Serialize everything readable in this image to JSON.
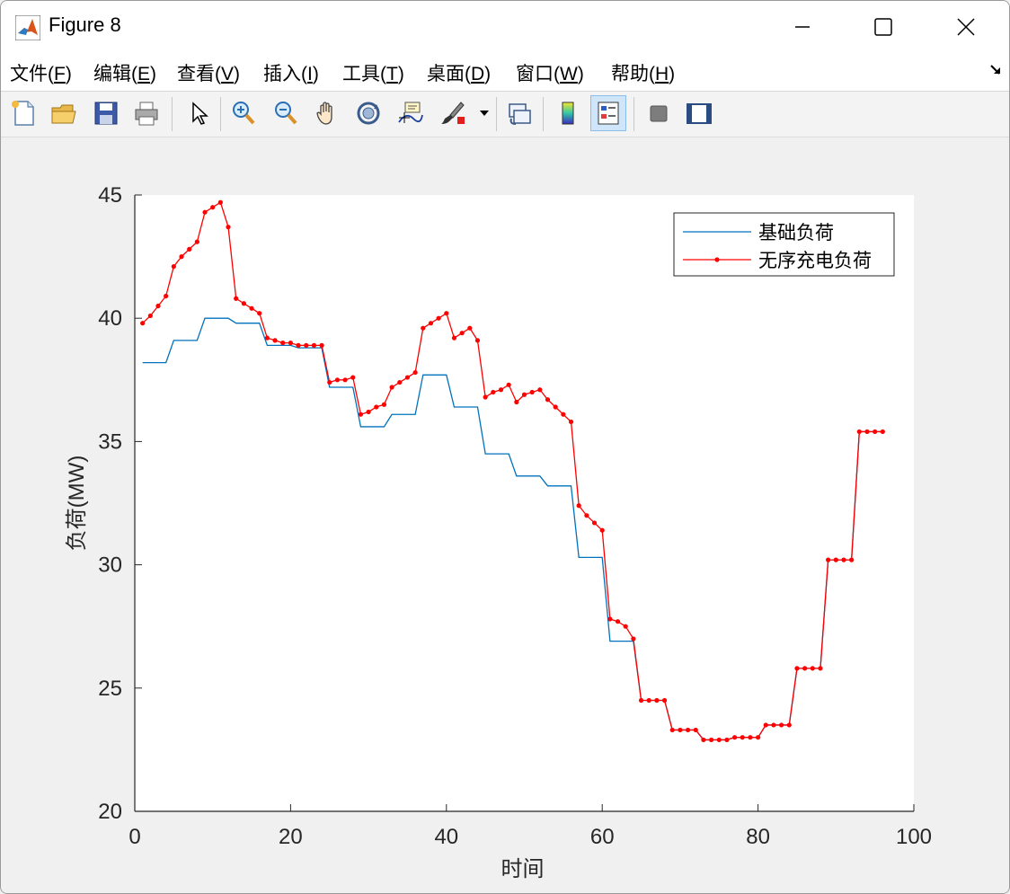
{
  "window": {
    "title": "Figure 8"
  },
  "menu": [
    {
      "label": "文件(",
      "key": "F",
      "tail": ")"
    },
    {
      "label": "编辑(",
      "key": "E",
      "tail": ")"
    },
    {
      "label": "查看(",
      "key": "V",
      "tail": ")"
    },
    {
      "label": "插入(",
      "key": "I",
      "tail": ")"
    },
    {
      "label": "工具(",
      "key": "T",
      "tail": ")"
    },
    {
      "label": "桌面(",
      "key": "D",
      "tail": ")"
    },
    {
      "label": "窗口(",
      "key": "W",
      "tail": ")"
    },
    {
      "label": "帮助(",
      "key": "H",
      "tail": ")"
    }
  ],
  "toolbar": {
    "buttons": [
      "new-figure",
      "open-file",
      "save",
      "print",
      "edit-plot",
      "zoom-in",
      "zoom-out",
      "pan",
      "rotate-3d",
      "data-cursor",
      "brush",
      "link-plot",
      "colorbar",
      "legend",
      "hide-plot-tools",
      "show-plot-tools"
    ],
    "active": "legend"
  },
  "chart_data": {
    "type": "line",
    "title": "",
    "xlabel": "时间",
    "ylabel": "负荷(MW)",
    "xlim": [
      0,
      100
    ],
    "ylim": [
      20,
      45
    ],
    "xticks": [
      0,
      20,
      40,
      60,
      80,
      100
    ],
    "yticks": [
      20,
      25,
      30,
      35,
      40,
      45
    ],
    "grid": false,
    "legend_position": "top-right",
    "series": [
      {
        "name": "基础负荷",
        "color": "#0072BD",
        "marker": "none",
        "x": [
          1,
          2,
          3,
          4,
          5,
          6,
          7,
          8,
          9,
          10,
          11,
          12,
          13,
          14,
          15,
          16,
          17,
          18,
          19,
          20,
          21,
          22,
          23,
          24,
          25,
          26,
          27,
          28,
          29,
          30,
          31,
          32,
          33,
          34,
          35,
          36,
          37,
          38,
          39,
          40,
          41,
          42,
          43,
          44,
          45,
          46,
          47,
          48,
          49,
          50,
          51,
          52,
          53,
          54,
          55,
          56,
          57,
          58,
          59,
          60,
          61,
          62,
          63,
          64,
          65,
          66,
          67,
          68,
          69,
          70,
          71,
          72,
          73,
          74,
          75,
          76,
          77,
          78,
          79,
          80,
          81,
          82,
          83,
          84,
          85,
          86,
          87,
          88,
          89,
          90,
          91,
          92,
          93,
          94,
          95,
          96
        ],
        "y": [
          38.2,
          38.2,
          38.2,
          38.2,
          39.1,
          39.1,
          39.1,
          39.1,
          40.0,
          40.0,
          40.0,
          40.0,
          39.8,
          39.8,
          39.8,
          39.8,
          38.9,
          38.9,
          38.9,
          38.9,
          38.8,
          38.8,
          38.8,
          38.8,
          37.2,
          37.2,
          37.2,
          37.2,
          35.6,
          35.6,
          35.6,
          35.6,
          36.1,
          36.1,
          36.1,
          36.1,
          37.7,
          37.7,
          37.7,
          37.7,
          36.4,
          36.4,
          36.4,
          36.4,
          34.5,
          34.5,
          34.5,
          34.5,
          33.6,
          33.6,
          33.6,
          33.6,
          33.2,
          33.2,
          33.2,
          33.2,
          30.3,
          30.3,
          30.3,
          30.3,
          26.9,
          26.9,
          26.9,
          26.9,
          24.5,
          24.5,
          24.5,
          24.5,
          23.3,
          23.3,
          23.3,
          23.3,
          22.9,
          22.9,
          22.9,
          22.9,
          23.0,
          23.0,
          23.0,
          23.0,
          23.5,
          23.5,
          23.5,
          23.5,
          25.8,
          25.8,
          25.8,
          25.8,
          30.2,
          30.2,
          30.2,
          30.2,
          35.4,
          35.4,
          35.4,
          35.4
        ]
      },
      {
        "name": "无序充电负荷",
        "color": "#FF0000",
        "marker": "dot",
        "x": [
          1,
          2,
          3,
          4,
          5,
          6,
          7,
          8,
          9,
          10,
          11,
          12,
          13,
          14,
          15,
          16,
          17,
          18,
          19,
          20,
          21,
          22,
          23,
          24,
          25,
          26,
          27,
          28,
          29,
          30,
          31,
          32,
          33,
          34,
          35,
          36,
          37,
          38,
          39,
          40,
          41,
          42,
          43,
          44,
          45,
          46,
          47,
          48,
          49,
          50,
          51,
          52,
          53,
          54,
          55,
          56,
          57,
          58,
          59,
          60,
          61,
          62,
          63,
          64,
          65,
          66,
          67,
          68,
          69,
          70,
          71,
          72,
          73,
          74,
          75,
          76,
          77,
          78,
          79,
          80,
          81,
          82,
          83,
          84,
          85,
          86,
          87,
          88,
          89,
          90,
          91,
          92,
          93,
          94,
          95,
          96
        ],
        "y": [
          39.8,
          40.1,
          40.5,
          40.9,
          42.1,
          42.5,
          42.8,
          43.1,
          44.3,
          44.5,
          44.7,
          43.7,
          40.8,
          40.6,
          40.4,
          40.2,
          39.2,
          39.1,
          39.0,
          39.0,
          38.9,
          38.9,
          38.9,
          38.9,
          37.4,
          37.5,
          37.5,
          37.6,
          36.1,
          36.2,
          36.4,
          36.5,
          37.2,
          37.4,
          37.6,
          37.8,
          39.6,
          39.8,
          40.0,
          40.2,
          39.2,
          39.4,
          39.6,
          39.1,
          36.8,
          37.0,
          37.1,
          37.3,
          36.6,
          36.9,
          37.0,
          37.1,
          36.7,
          36.4,
          36.1,
          35.8,
          32.4,
          32.0,
          31.7,
          31.4,
          27.8,
          27.7,
          27.5,
          27.0,
          24.5,
          24.5,
          24.5,
          24.5,
          23.3,
          23.3,
          23.3,
          23.3,
          22.9,
          22.9,
          22.9,
          22.9,
          23.0,
          23.0,
          23.0,
          23.0,
          23.5,
          23.5,
          23.5,
          23.5,
          25.8,
          25.8,
          25.8,
          25.8,
          30.2,
          30.2,
          30.2,
          30.2,
          35.4,
          35.4,
          35.4,
          35.4
        ]
      }
    ]
  }
}
